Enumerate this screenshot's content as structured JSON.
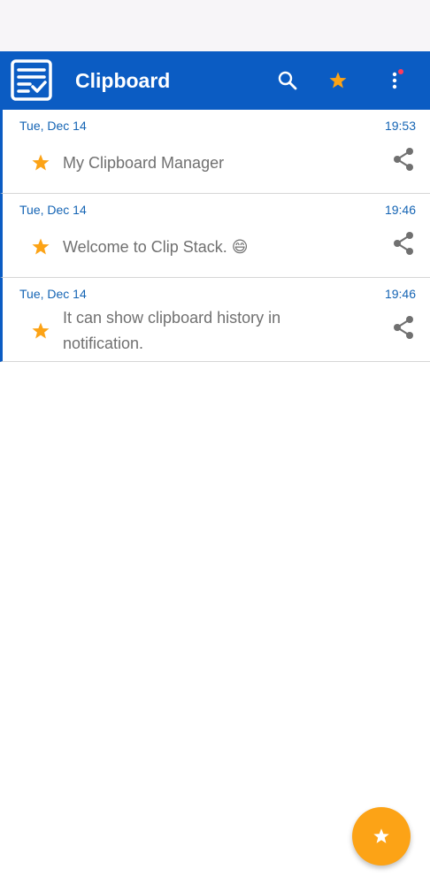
{
  "app_bar": {
    "title": "Clipboard",
    "logo_icon": "clipboard-check-icon",
    "actions": [
      {
        "icon": "search-icon"
      },
      {
        "icon": "star-icon"
      },
      {
        "icon": "more-vert-icon"
      }
    ]
  },
  "clips": [
    {
      "date": "Tue, Dec 14",
      "time": "19:53",
      "text": "My Clipboard Manager",
      "starred": true
    },
    {
      "date": "Tue, Dec 14",
      "time": "19:46",
      "text": "Welcome to Clip Stack. 😄",
      "starred": true
    },
    {
      "date": "Tue, Dec 14",
      "time": "19:46",
      "text": "It can show clipboard history in notification.",
      "starred": true
    }
  ],
  "fab": {
    "icon": "star-icon"
  },
  "colors": {
    "primary": "#0b5cc3",
    "accent": "#fca316",
    "date_text": "#1464b4",
    "body_text": "#707070",
    "status_bar": "#f7f5f8",
    "notification_dot": "#ff3b5c"
  }
}
